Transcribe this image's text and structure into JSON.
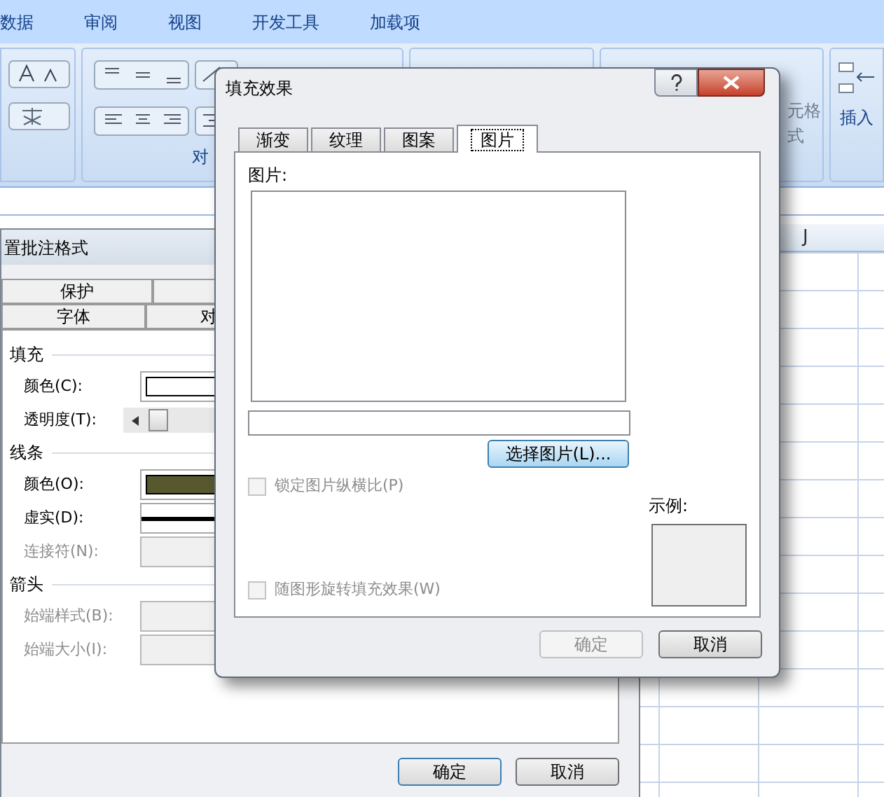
{
  "ribbon": {
    "tabs": [
      "数据",
      "审阅",
      "视图",
      "开发工具",
      "加载项"
    ],
    "group_label": "对",
    "cell_style_labels": [
      "元格",
      "式"
    ],
    "insert_label": "插入"
  },
  "sheet": {
    "column_header": "J"
  },
  "format_dialog": {
    "title": "置批注格式",
    "tabs_row1": [
      "保护"
    ],
    "tabs_row2": [
      "字体",
      "对"
    ],
    "sections": [
      {
        "heading": "填充",
        "rows": [
          {
            "kind": "color",
            "label": "颜色(C):",
            "color": "#ffffff"
          },
          {
            "kind": "slider",
            "label": "透明度(T):",
            "level": 0
          }
        ]
      },
      {
        "heading": "线条",
        "rows": [
          {
            "kind": "color",
            "label": "颜色(O):",
            "color": "#58582f"
          },
          {
            "kind": "line",
            "label": "虚实(D):"
          },
          {
            "kind": "field",
            "label": "连接符(N):",
            "disabled": true
          }
        ]
      },
      {
        "heading": "箭头",
        "rows": [
          {
            "kind": "field",
            "label": "始端样式(B):",
            "disabled": true
          },
          {
            "kind": "field",
            "label": "始端大小(I):",
            "disabled": true
          }
        ]
      }
    ],
    "ok_button": "确定",
    "cancel_button": "取消"
  },
  "fill_dialog": {
    "title": "填充效果",
    "tabs": [
      {
        "label": "渐变",
        "selected": false
      },
      {
        "label": "纹理",
        "selected": false
      },
      {
        "label": "图案",
        "selected": false
      },
      {
        "label": "图片",
        "selected": true
      }
    ],
    "picture_label": "图片:",
    "select_button": "选择图片(L)...",
    "lock_aspect": {
      "label": "锁定图片纵横比(P)",
      "checked": false,
      "disabled": true
    },
    "sample_label": "示例:",
    "rotate_with_shape": {
      "label": "随图形旋转填充效果(W)",
      "checked": false,
      "disabled": true
    },
    "ok_button": {
      "label": "确定",
      "disabled": true
    },
    "cancel_button": {
      "label": "取消",
      "disabled": false
    }
  }
}
